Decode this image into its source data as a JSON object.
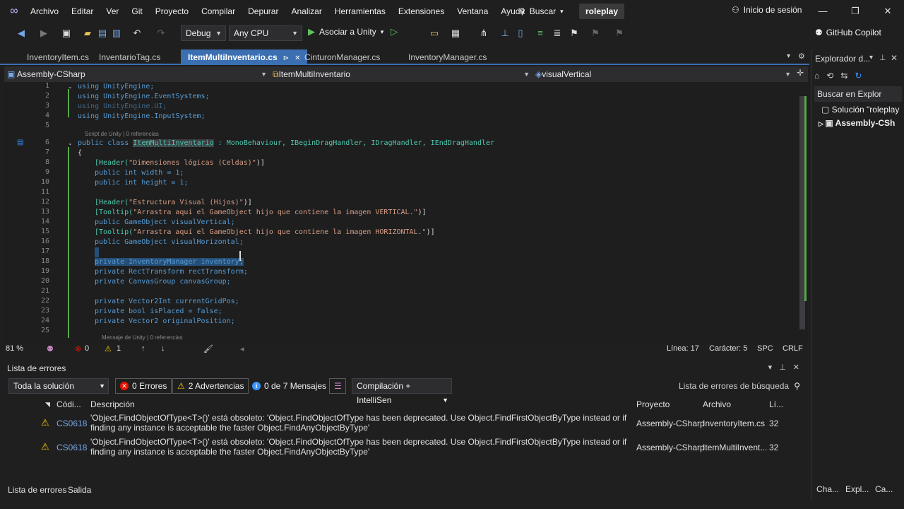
{
  "menubar": {
    "items": [
      "Archivo",
      "Editar",
      "Ver",
      "Git",
      "Proyecto",
      "Compilar",
      "Depurar",
      "Analizar",
      "Herramientas",
      "Extensiones",
      "Ventana",
      "Ayuda"
    ],
    "search_label": "Buscar",
    "solution_name": "roleplay",
    "signin_label": "Inicio de sesión"
  },
  "toolbar": {
    "config": "Debug",
    "platform": "Any CPU",
    "attach_label": "Asociar a Unity",
    "copilot_label": "GitHub Copilot"
  },
  "tabs": [
    {
      "label": "InventoryItem.cs"
    },
    {
      "label": "InventarioTag.cs"
    },
    {
      "label": "ItemMultiInventario.cs",
      "active": true
    },
    {
      "label": "CinturonManager.cs"
    },
    {
      "label": "InventoryManager.cs"
    }
  ],
  "navbar": {
    "project": "Assembly-CSharp",
    "class": "ItemMultiInventario",
    "member": "visualVertical"
  },
  "editor": {
    "line_numbers": [
      "1",
      "2",
      "3",
      "4",
      "5",
      "6",
      "7",
      "8",
      "9",
      "10",
      "11",
      "12",
      "13",
      "14",
      "15",
      "16",
      "17",
      "18",
      "19",
      "20",
      "21",
      "22",
      "23",
      "24",
      "25"
    ],
    "lens_script": "Script de Unity | 0 referencias",
    "lens_message": "Mensaje de Unity | 0 referencias",
    "lines": {
      "l1": "using UnityEngine;",
      "l2": "using UnityEngine.EventSystems;",
      "l3": "using UnityEngine.UI;",
      "l4": "using UnityEngine.InputSystem;",
      "l6a": "public class ",
      "l6b": "ItemMultiInventario",
      "l6c": " : MonoBehaviour, IBeginDragHandler, IDragHandler, IEndDragHandler",
      "l7": "{",
      "l8a": "[Header(",
      "l8b": "\"Dimensiones lógicas (Celdas)\"",
      "l8c": ")]",
      "l9": "public int width = 1;",
      "l10": "public int height = 1;",
      "l12a": "[Header(",
      "l12b": "\"Estructura Visual (Hijos)\"",
      "l12c": ")]",
      "l13a": "[Tooltip(",
      "l13b": "\"Arrastra aquí el GameObject hijo que contiene la imagen VERTICAL.\"",
      "l13c": ")]",
      "l14": "public GameObject visualVertical;",
      "l15a": "[Tooltip(",
      "l15b": "\"Arrastra aquí el GameObject hijo que contiene la imagen HORIZONTAL.\"",
      "l15c": ")]",
      "l16": "public GameObject visualHorizontal;",
      "l18": "private InventoryManager inventory;",
      "l19": "private RectTransform rectTransform;",
      "l20": "private CanvasGroup canvasGroup;",
      "l22": "private Vector2Int currentGridPos;",
      "l23": "private bool isPlaced = false;",
      "l24": "private Vector2 originalPosition;"
    }
  },
  "edstatus": {
    "zoom": "81 %",
    "errors": "0",
    "warnings": "1",
    "line": "Línea: 17",
    "char": "Carácter: 5",
    "spc": "SPC",
    "crlf": "CRLF"
  },
  "errorlist": {
    "title": "Lista de errores",
    "scope": "Toda la solución",
    "errors_chip": "0 Errores",
    "warnings_chip": "2 Advertencias",
    "messages_chip": "0 de 7 Mensajes",
    "build_filter": "Compilación + IntelliSen",
    "search_placeholder": "Lista de errores de búsqueda",
    "columns": [
      "Códi...",
      "Descripción",
      "Proyecto",
      "Archivo",
      "Lí..."
    ],
    "rows": [
      {
        "code": "CS0618",
        "desc": "'Object.FindObjectOfType<T>()' está obsoleto: 'Object.FindObjectOfType has been deprecated. Use Object.FindFirstObjectByType instead or if finding any instance is acceptable the faster Object.FindAnyObjectByType'",
        "project": "Assembly-CSharp",
        "file": "InventoryItem.cs",
        "line": "32"
      },
      {
        "code": "CS0618",
        "desc": "'Object.FindObjectOfType<T>()' está obsoleto: 'Object.FindObjectOfType has been deprecated. Use Object.FindFirstObjectByType instead or if finding any instance is acceptable the faster Object.FindAnyObjectByType'",
        "project": "Assembly-CSharp",
        "file": "ItemMultiInvent...",
        "line": "32"
      }
    ]
  },
  "bottomtabs": [
    "Lista de errores",
    "Salida"
  ],
  "solution_explorer": {
    "title": "Explorador d...",
    "search": "Buscar en Explor",
    "solution_item": "Solución \"roleplay",
    "project_item": "Assembly-CSh",
    "bottom_tabs": [
      "Cha...",
      "Expl...",
      "Ca..."
    ]
  },
  "colors": {
    "accent": "#3b6fb2",
    "background": "#1f1f1f",
    "keyword": "#569cd6",
    "type": "#4ec9b0",
    "string": "#d69d85"
  }
}
